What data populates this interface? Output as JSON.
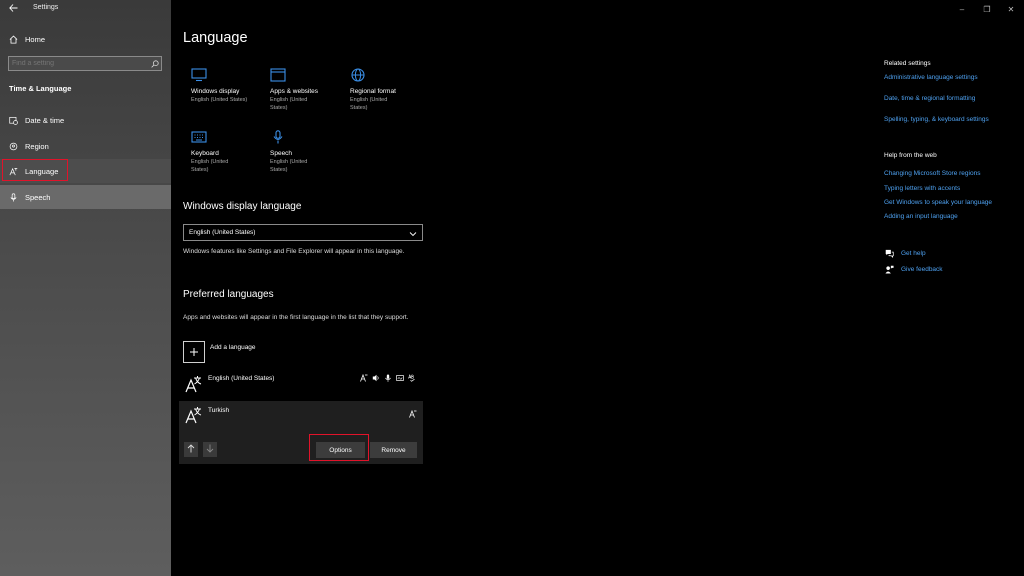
{
  "app": {
    "title": "Settings"
  },
  "window_controls": {
    "minimize": "–",
    "restore": "❐",
    "close": "✕"
  },
  "sidebar": {
    "home_label": "Home",
    "search_placeholder": "Find a setting",
    "section_title": "Time & Language",
    "items": [
      {
        "label": "Date & time",
        "icon": "calendar-clock-icon"
      },
      {
        "label": "Region",
        "icon": "globe-pin-icon"
      },
      {
        "label": "Language",
        "icon": "language-icon"
      },
      {
        "label": "Speech",
        "icon": "microphone-icon"
      }
    ]
  },
  "main": {
    "title": "Language",
    "tiles": [
      {
        "name": "Windows display",
        "sub": "English (United States)",
        "icon": "monitor-icon"
      },
      {
        "name": "Apps & websites",
        "sub": "English (United States)",
        "icon": "window-icon"
      },
      {
        "name": "Regional format",
        "sub": "English (United States)",
        "icon": "globe-icon"
      },
      {
        "name": "Keyboard",
        "sub": "English (United States)",
        "icon": "keyboard-icon"
      },
      {
        "name": "Speech",
        "sub": "English (United States)",
        "icon": "microphone-icon"
      }
    ],
    "display_language": {
      "heading": "Windows display language",
      "selected": "English (United States)",
      "description": "Windows features like Settings and File Explorer will appear in this language."
    },
    "preferred": {
      "heading": "Preferred languages",
      "description": "Apps and websites will appear in the first language in the list that they support.",
      "add_label": "Add a language",
      "languages": [
        {
          "name": "English (United States)"
        },
        {
          "name": "Turkish"
        }
      ],
      "options_label": "Options",
      "remove_label": "Remove"
    }
  },
  "related": {
    "title": "Related settings",
    "links": [
      "Administrative language settings",
      "Date, time & regional formatting",
      "Spelling, typing, & keyboard settings"
    ]
  },
  "help_web": {
    "title": "Help from the web",
    "links": [
      "Changing Microsoft Store regions",
      "Typing letters with accents",
      "Get Windows to speak your language",
      "Adding an input language"
    ]
  },
  "support": {
    "get_help": "Get help",
    "give_feedback": "Give feedback"
  },
  "colors": {
    "accent_link": "#4ea1f0",
    "tile_icon": "#3a8ee6",
    "highlight_border": "#e1132a"
  }
}
